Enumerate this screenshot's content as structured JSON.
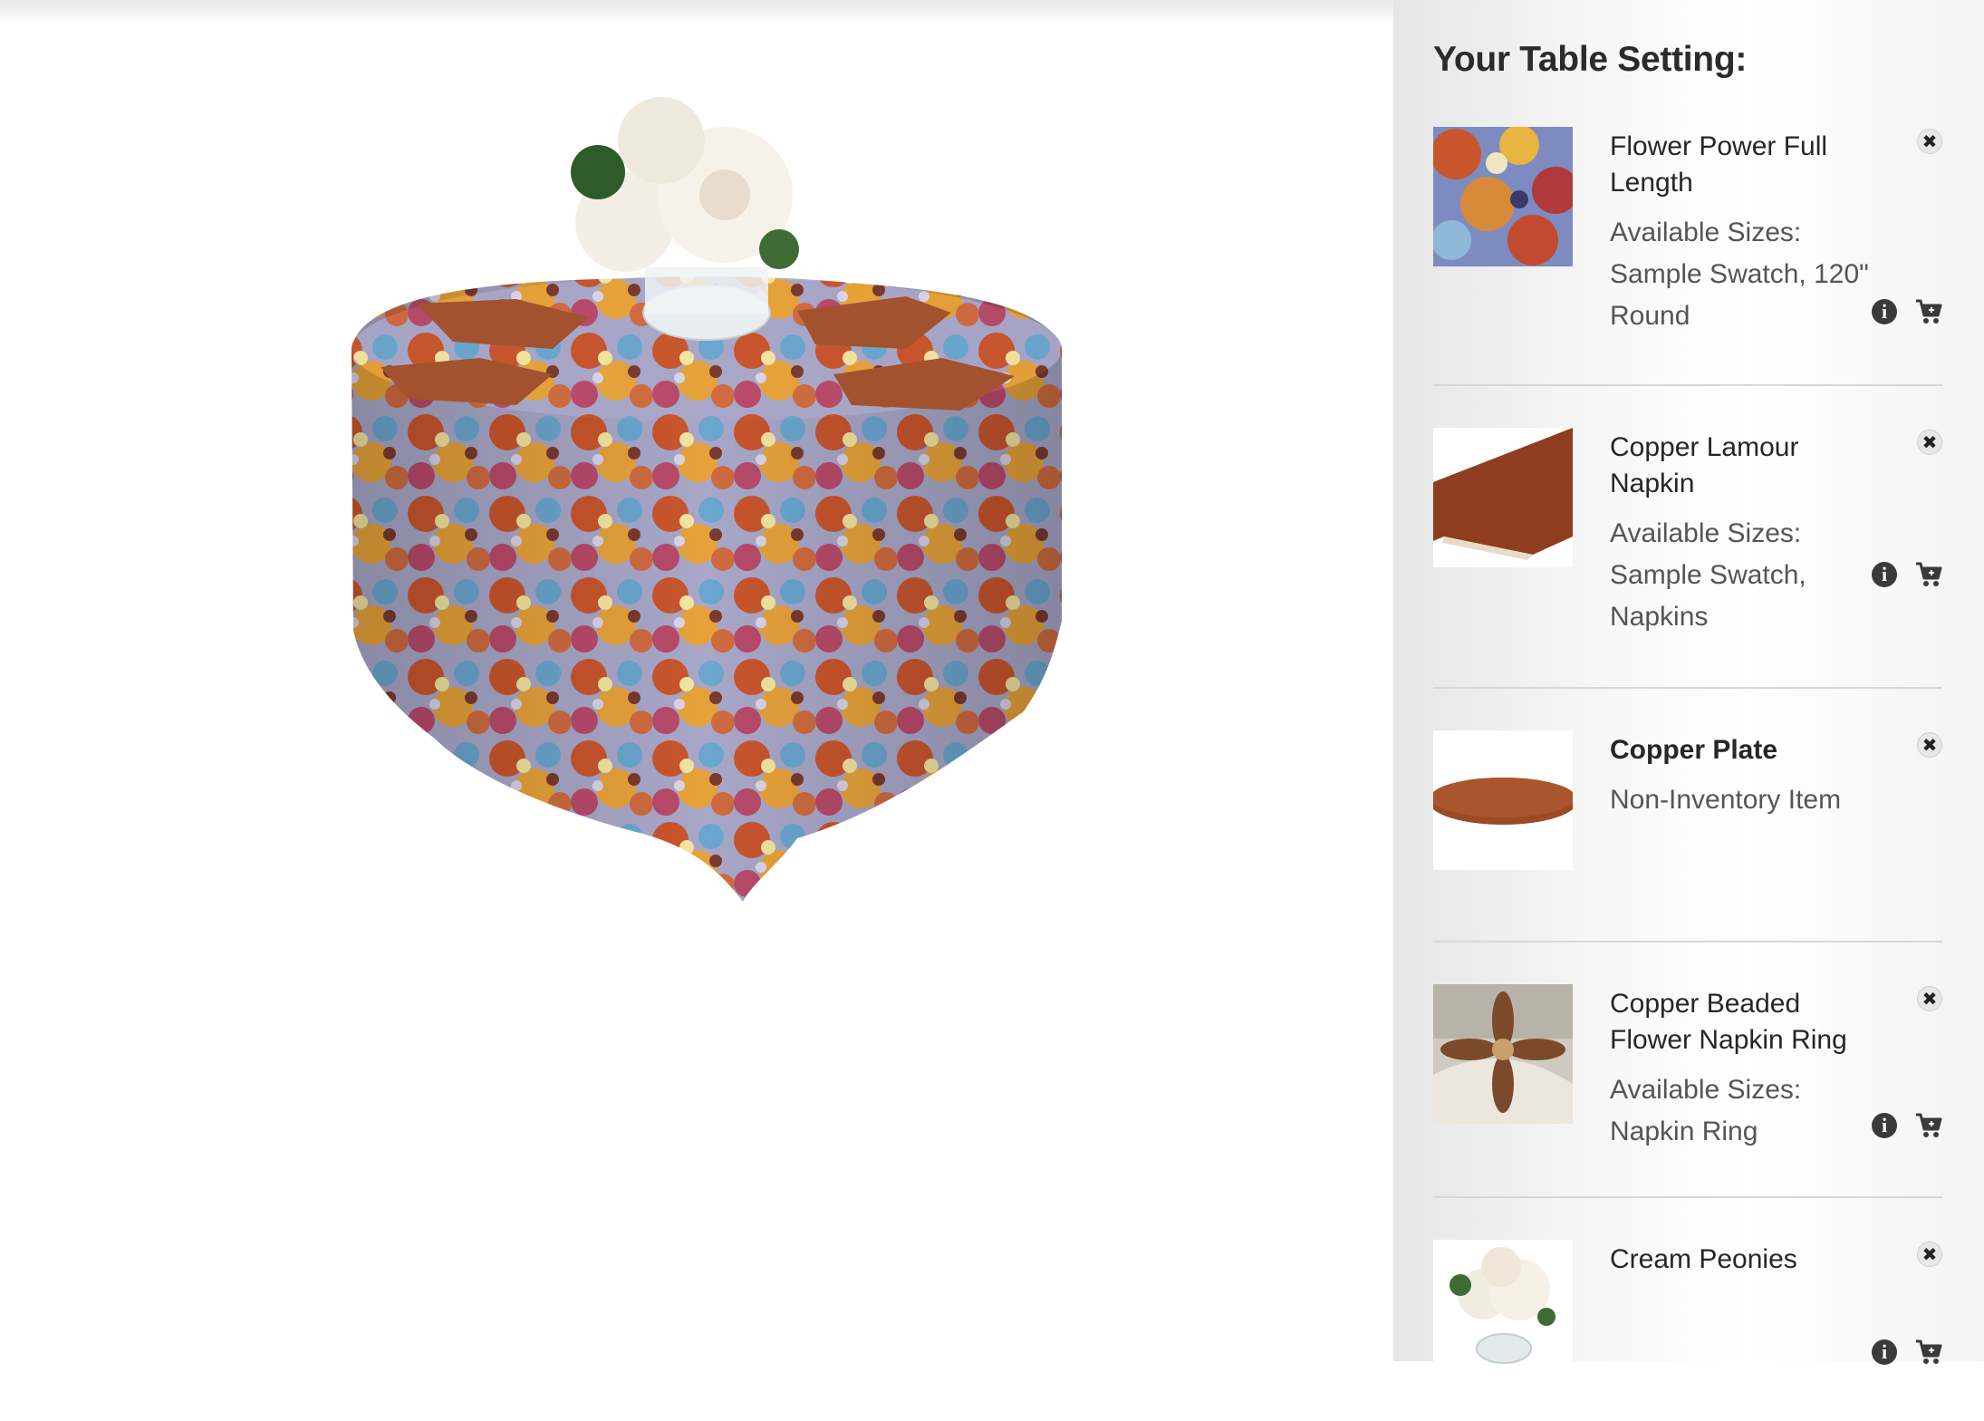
{
  "sidebar": {
    "title": "Your Table Setting:",
    "items": [
      {
        "name": "Flower Power Full Length",
        "sizes_label": "Available Sizes:",
        "sizes": "Sample Swatch, 120\" Round",
        "remove_icon": "close-circle-icon",
        "info_icon": "info-circle-icon",
        "cart_icon": "cart-plus-icon"
      },
      {
        "name": "Copper Lamour Napkin",
        "sizes_label": "Available Sizes:",
        "sizes": "Sample Swatch, Napkins",
        "remove_icon": "close-circle-icon",
        "info_icon": "info-circle-icon",
        "cart_icon": "cart-plus-icon"
      },
      {
        "name": "Copper Plate",
        "note": "Non-Inventory Item",
        "remove_icon": "close-circle-icon"
      },
      {
        "name": "Copper Beaded Flower Napkin Ring",
        "sizes_label": "Available Sizes:",
        "sizes": "Napkin Ring",
        "remove_icon": "close-circle-icon",
        "info_icon": "info-circle-icon",
        "cart_icon": "cart-plus-icon"
      },
      {
        "name": "Cream Peonies",
        "remove_icon": "close-circle-icon",
        "info_icon": "info-circle-icon",
        "cart_icon": "cart-plus-icon"
      }
    ]
  },
  "colors": {
    "copper": "#9a4a2a",
    "sidebar_bg": "#f2f2f2",
    "divider": "#d7d7d7"
  }
}
